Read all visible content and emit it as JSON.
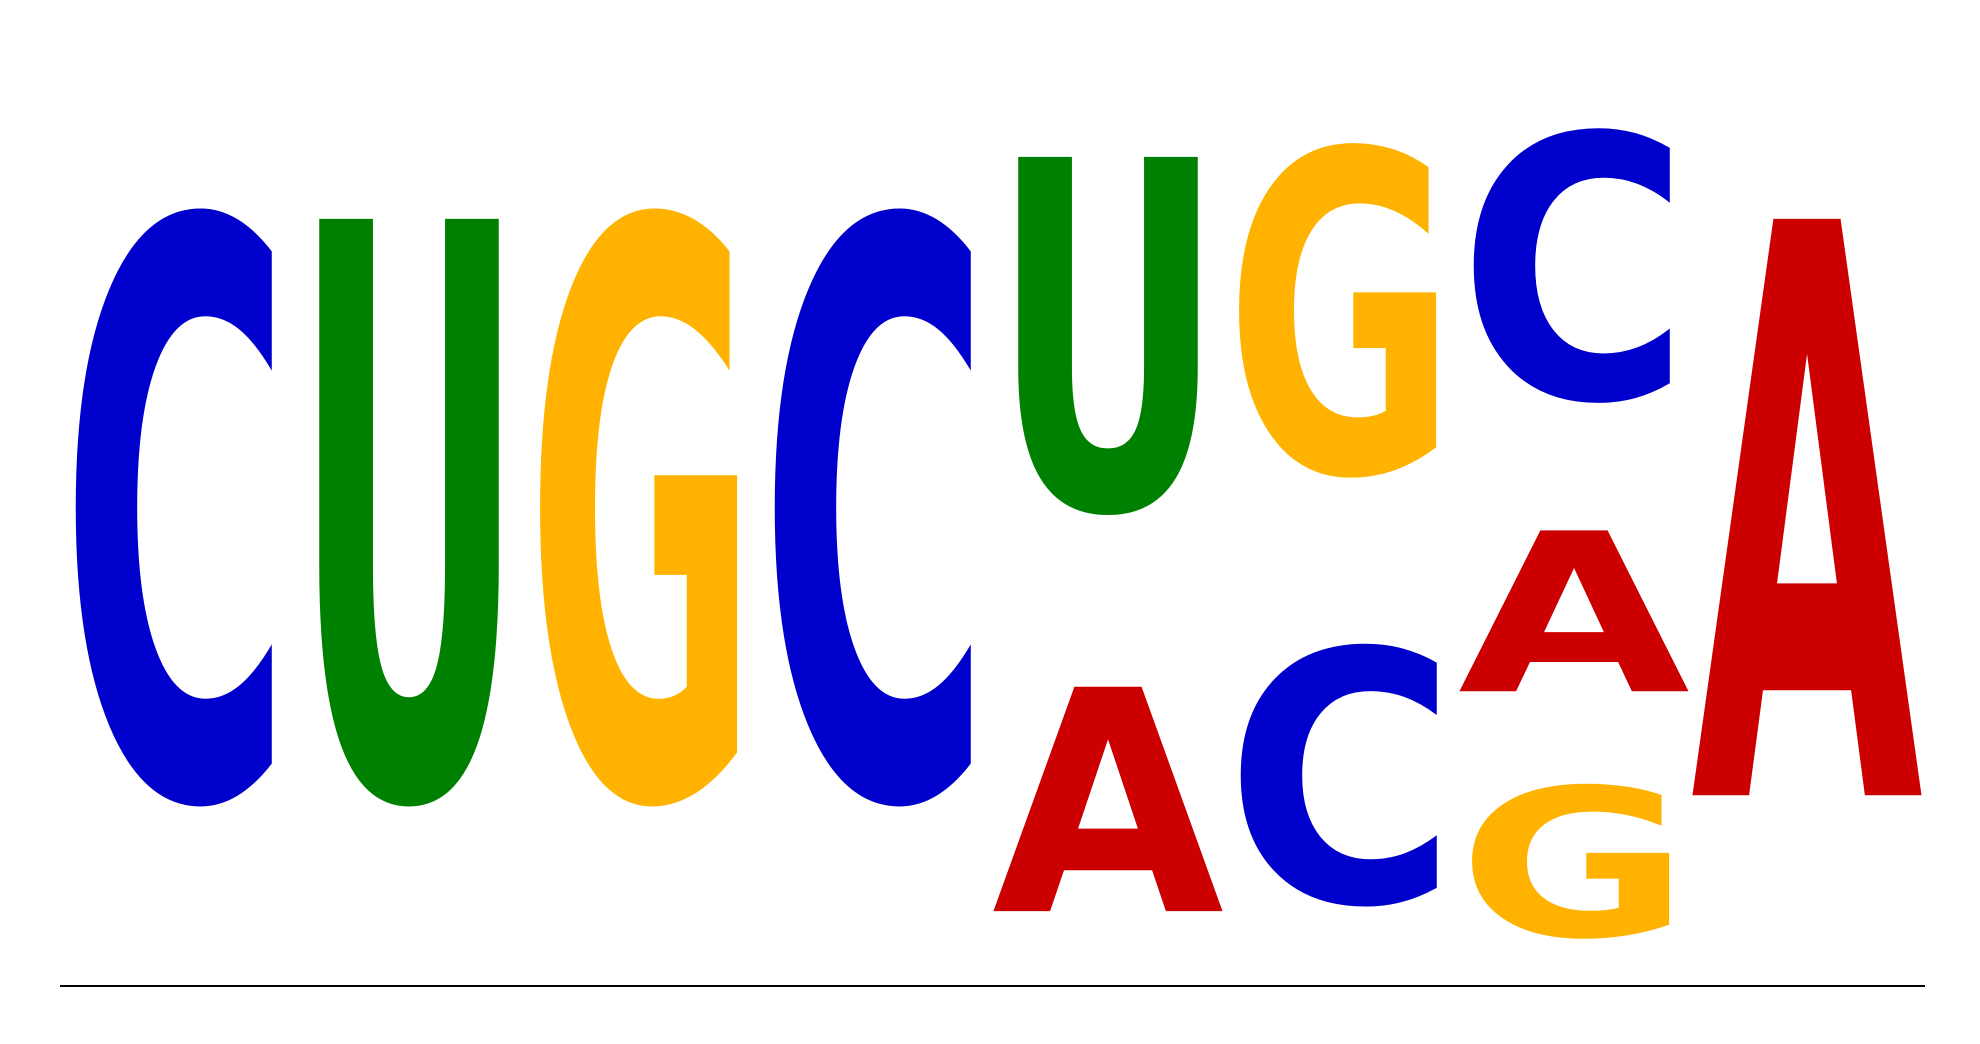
{
  "chart_data": {
    "type": "sequence-logo",
    "alphabet": [
      "A",
      "C",
      "G",
      "U"
    ],
    "colors": {
      "A": "#cc0000",
      "C": "#0000cc",
      "G": "#ffb300",
      "U": "#008000"
    },
    "ylim": [
      0,
      2
    ],
    "positions": [
      {
        "stack": [
          {
            "letter": "C",
            "height": 2.0
          }
        ]
      },
      {
        "stack": [
          {
            "letter": "U",
            "height": 2.0
          }
        ]
      },
      {
        "stack": [
          {
            "letter": "G",
            "height": 2.0
          }
        ]
      },
      {
        "stack": [
          {
            "letter": "C",
            "height": 2.0
          }
        ]
      },
      {
        "stack": [
          {
            "letter": "A",
            "height": 0.78
          },
          {
            "letter": "U",
            "height": 1.22
          }
        ]
      },
      {
        "stack": [
          {
            "letter": "C",
            "height": 0.88
          },
          {
            "letter": "G",
            "height": 1.12
          }
        ]
      },
      {
        "stack": [
          {
            "letter": "G",
            "height": 0.52
          },
          {
            "letter": "A",
            "height": 0.56
          },
          {
            "letter": "C",
            "height": 0.92
          }
        ]
      },
      {
        "stack": [
          {
            "letter": "A",
            "height": 2.0
          }
        ]
      }
    ]
  }
}
